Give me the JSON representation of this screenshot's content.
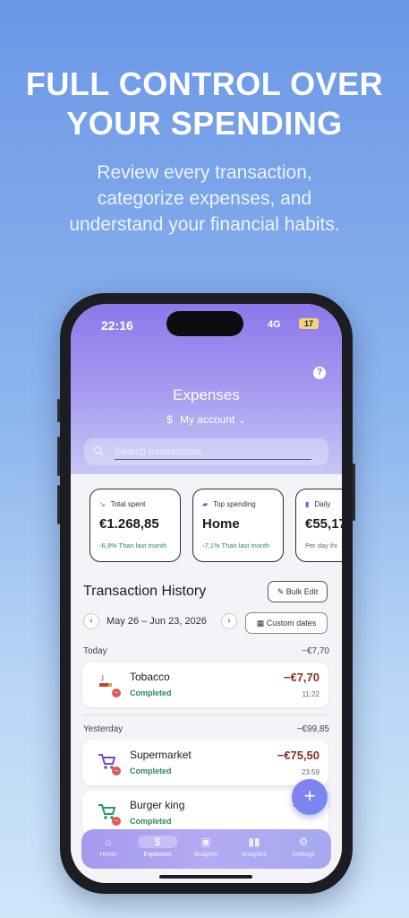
{
  "headline": [
    "FULL CONTROL OVER",
    "YOUR SPENDING"
  ],
  "subheadline": [
    "Review every transaction,",
    "categorize expenses, and",
    "understand your financial habits."
  ],
  "status_bar": {
    "time": "22:16",
    "network": "4G",
    "battery": "17"
  },
  "header": {
    "help": "?",
    "title": "Expenses",
    "account_icon": "$",
    "account": "My account",
    "account_chevron": "⌄"
  },
  "search": {
    "placeholder": "Search transactions..."
  },
  "cards": [
    {
      "label": "Total spent",
      "value": "€1.268,85",
      "note": "-6,9% Than last month"
    },
    {
      "label": "Top spending",
      "value": "Home",
      "note": "-7,1% Than last month"
    },
    {
      "label": "Daily",
      "value": "€55,17",
      "note": "Per day thi"
    }
  ],
  "history": {
    "title": "Transaction History",
    "bulk_edit": "Bulk Edit",
    "range": "May 26 – Jun 23, 2026",
    "custom_dates": "Custom dates",
    "prev": "‹",
    "next": "›"
  },
  "groups": [
    {
      "label": "Today",
      "total": "−€7,70",
      "items": [
        {
          "name": "Tobacco",
          "status": "Completed",
          "amount": "−€7,70",
          "time": "11:22",
          "icon": "cigarette-icon"
        }
      ]
    },
    {
      "label": "Yesterday",
      "total": "−€99,85",
      "items": [
        {
          "name": "Supermarket",
          "status": "Completed",
          "amount": "−€75,50",
          "time": "23:59",
          "icon": "cart-icon"
        },
        {
          "name": "Burger king",
          "status": "Completed",
          "amount": "−",
          "time": "",
          "icon": "cart-icon"
        }
      ]
    }
  ],
  "fab": "+",
  "tabs": [
    {
      "label": "Home",
      "icon": "home-icon"
    },
    {
      "label": "Expenses",
      "icon": "dollar-icon",
      "active": true
    },
    {
      "label": "Budgets",
      "icon": "wallet-icon"
    },
    {
      "label": "Analytics",
      "icon": "bar-chart-icon"
    },
    {
      "label": "Settings",
      "icon": "gear-icon"
    }
  ],
  "colors": {
    "accent": "#8c78ea",
    "negative": "#8f2a2a",
    "positive": "#2b8a5a"
  }
}
